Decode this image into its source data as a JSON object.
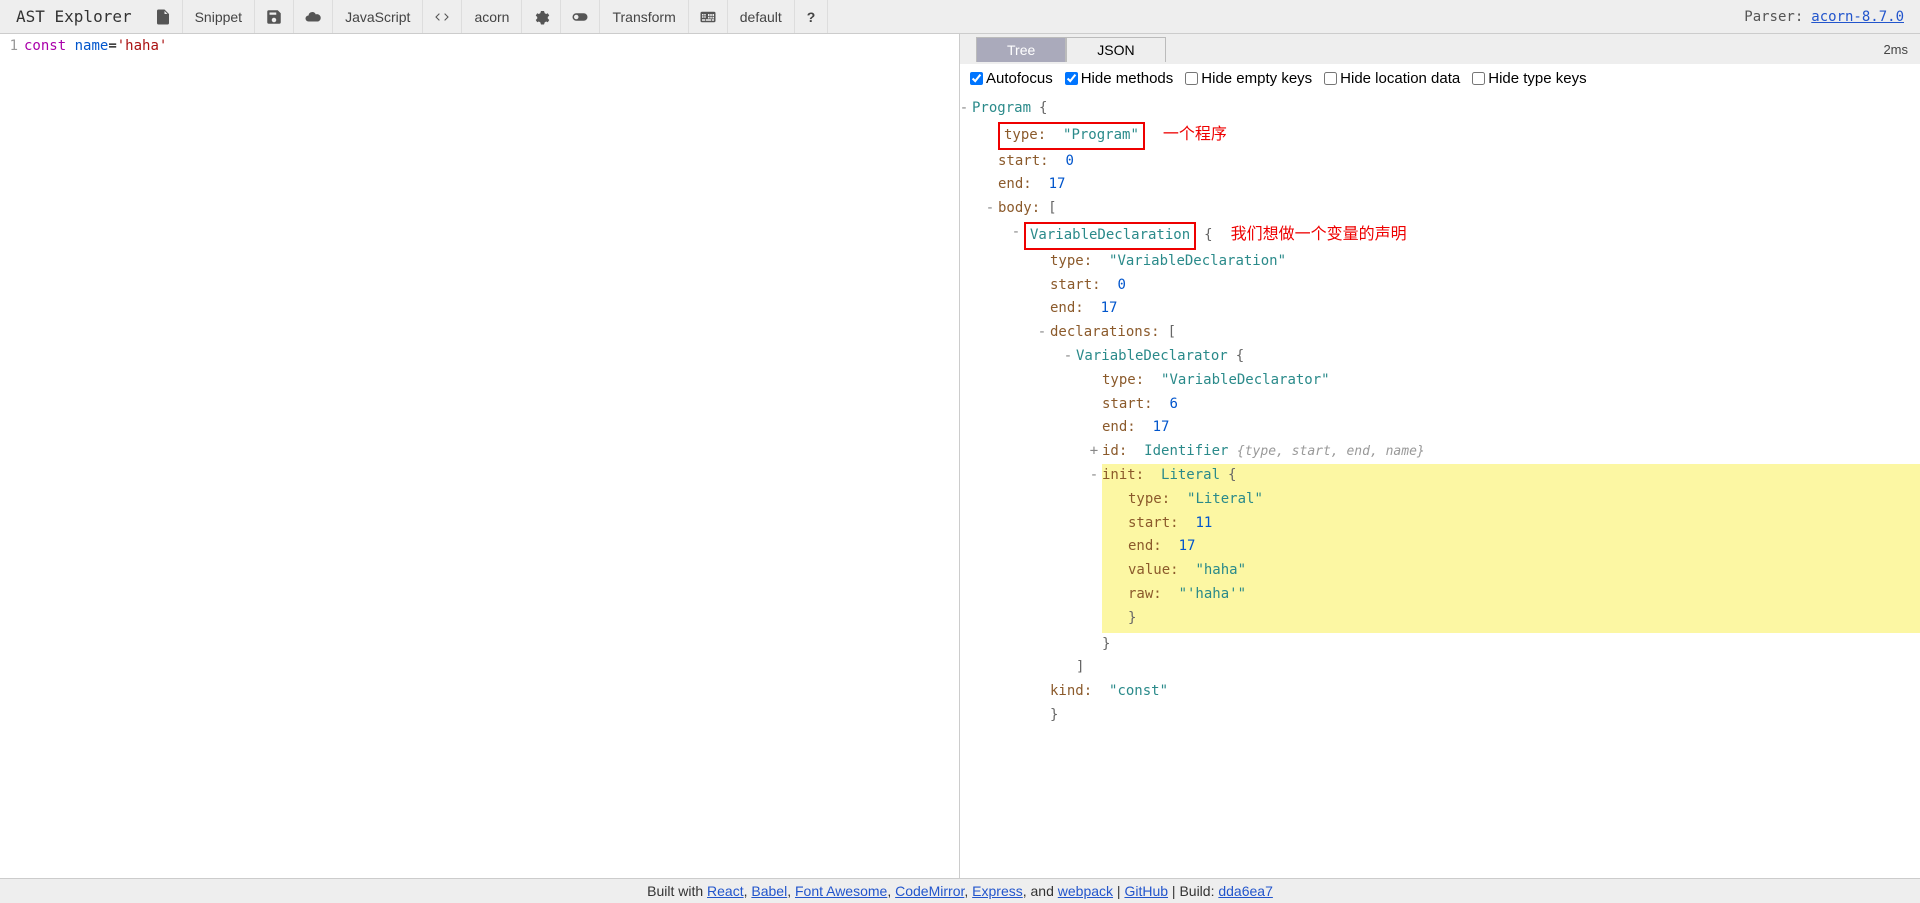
{
  "toolbar": {
    "title": "AST Explorer",
    "snippet": "Snippet",
    "language": "JavaScript",
    "parser": "acorn",
    "transform": "Transform",
    "default": "default",
    "help": "?",
    "parser_label": "Parser: ",
    "parser_link": "acorn-8.7.0"
  },
  "editor": {
    "line_no": "1",
    "kw": "const",
    "ident": " name",
    "eq": "=",
    "str": "'haha'"
  },
  "tabs": {
    "tree": "Tree",
    "json": "JSON",
    "time": "2ms"
  },
  "options": {
    "autofocus": "Autofocus",
    "hide_methods": "Hide methods",
    "hide_empty": "Hide empty keys",
    "hide_location": "Hide location data",
    "hide_type": "Hide type keys"
  },
  "tree": {
    "program": "Program",
    "type_k": "type:",
    "start_k": "start:",
    "end_k": "end:",
    "body_k": "body:",
    "decls_k": "declarations:",
    "id_k": "id:",
    "init_k": "init:",
    "value_k": "value:",
    "raw_k": "raw:",
    "kind_k": "kind:",
    "program_q": "\"Program\"",
    "vd": "VariableDeclaration",
    "vd_q": "\"VariableDeclaration\"",
    "vdecl": "VariableDeclarator",
    "vdecl_q": "\"VariableDeclarator\"",
    "ident": "Identifier",
    "ident_summary": "{type, start, end, name}",
    "lit": "Literal",
    "lit_q": "\"Literal\"",
    "haha_q": "\"haha\"",
    "haha_raw": "\"'haha'\"",
    "const_q": "\"const\"",
    "n0": "0",
    "n6": "6",
    "n11": "11",
    "n17": "17"
  },
  "annot": {
    "a1": "一个程序",
    "a2": "我们想做一个变量的声明"
  },
  "footer": {
    "prefix": "Built with ",
    "react": "React",
    "c1": ", ",
    "babel": "Babel",
    "c2": ", ",
    "fa": "Font Awesome",
    "c3": ", ",
    "cm": "CodeMirror",
    "c4": ", ",
    "express": "Express",
    "c5": ", and ",
    "webpack": "webpack",
    "sep": " | ",
    "github": "GitHub",
    "build_prefix": " | Build: ",
    "build": "dda6ea7"
  }
}
